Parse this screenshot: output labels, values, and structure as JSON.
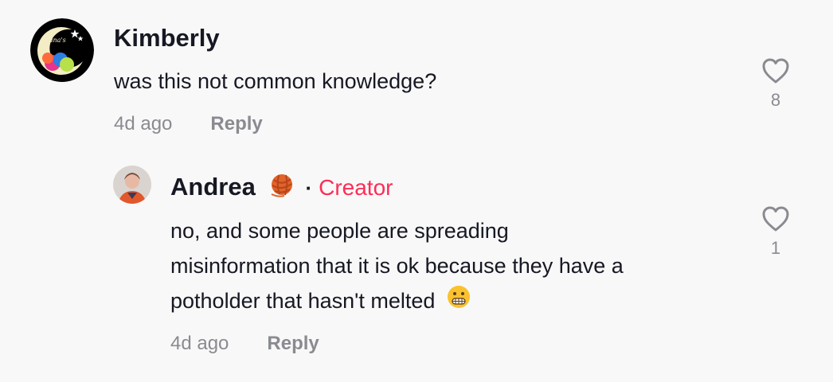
{
  "comments": [
    {
      "author": "Kimberly",
      "avatar_text": "Luna's",
      "text": "was this not common knowledge?",
      "time": "4d ago",
      "reply_label": "Reply",
      "likes": "8"
    },
    {
      "author": "Andrea",
      "badge_separator": "·",
      "badge": "Creator",
      "text_lines": [
        "no, and some people are spreading",
        "misinformation that it is ok because they have a",
        "potholder that hasn't melted"
      ],
      "time": "4d ago",
      "reply_label": "Reply",
      "likes": "1"
    }
  ],
  "colors": {
    "creator": "#fe2c55",
    "muted": "#8a8b91",
    "text": "#161823",
    "background": "#f8f8f8"
  }
}
